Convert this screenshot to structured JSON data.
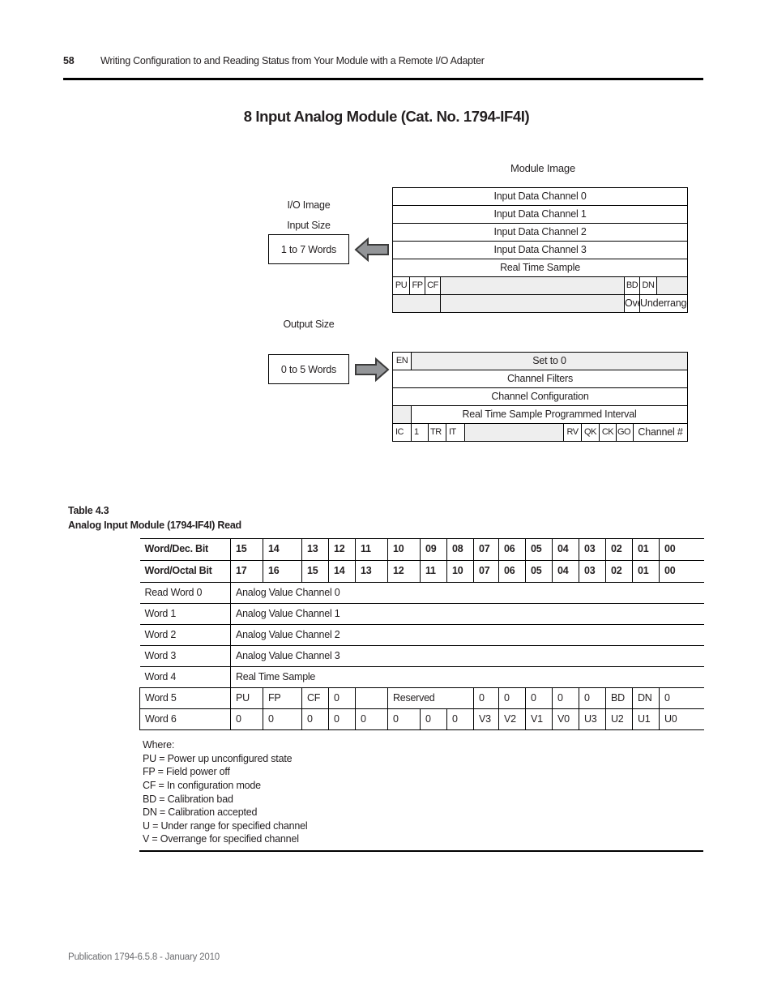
{
  "header": {
    "page_number": "58",
    "title": "Writing Configuration to and Reading Status from Your Module with a Remote I/O Adapter"
  },
  "section": {
    "title": "8 Input Analog Module (Cat. No. 1794-IF4I)"
  },
  "diagram": {
    "module_image_label": "Module Image",
    "io_image_label": "I/O Image",
    "input_size_label": "Input Size",
    "input_size_value": "1 to 7 Words",
    "output_size_label": "Output Size",
    "output_size_value": "0 to 5 Words",
    "input_arrow_icon": "arrow-left-icon",
    "output_arrow_icon": "arrow-right-icon",
    "input_rows": [
      "Input Data Channel 0",
      "Input Data Channel 1",
      "Input Data Channel 2",
      "Input Data Channel 3",
      "Real Time Sample"
    ],
    "input_status_row": {
      "pu": "PU",
      "fp": "FP",
      "cf": "CF",
      "bd": "BD",
      "dn": "DN"
    },
    "input_range_row": {
      "overrange": "Overrange",
      "underrange": "Underrange"
    },
    "output_row_1": {
      "en": "EN",
      "set_to_0": "Set to 0"
    },
    "output_rows": [
      "Channel  Filters",
      "Channel Configuration"
    ],
    "output_rts_row": {
      "label": "Real Time Sample Programmed Interval"
    },
    "output_bit_row": {
      "ic": "IC",
      "one": "1",
      "tr": "TR",
      "it": "IT",
      "rv": "RV",
      "qk": "QK",
      "ck": "CK",
      "go": "GO",
      "channel": "Channel #"
    }
  },
  "table": {
    "caption_line1": "Table 4.3",
    "caption_line2": "Analog Input Module (1794-IF4I) Read",
    "header_dec": {
      "label": "Word/Dec. Bit",
      "bits": [
        "15",
        "14",
        "13",
        "12",
        "11",
        "10",
        "09",
        "08",
        "07",
        "06",
        "05",
        "04",
        "03",
        "02",
        "01",
        "00"
      ]
    },
    "header_octal": {
      "label": "Word/Octal Bit",
      "bits": [
        "17",
        "16",
        "15",
        "14",
        "13",
        "12",
        "11",
        "10",
        "07",
        "06",
        "05",
        "04",
        "03",
        "02",
        "01",
        "00"
      ]
    },
    "spanned_rows": [
      {
        "word": "Read Word 0",
        "value": "Analog Value Channel 0"
      },
      {
        "word": "Word 1",
        "value": "Analog Value Channel 1"
      },
      {
        "word": "Word 2",
        "value": "Analog Value Channel 2"
      },
      {
        "word": "Word 3",
        "value": "Analog Value Channel 3"
      },
      {
        "word": "Word 4",
        "value": "Real Time Sample"
      }
    ],
    "word5": {
      "word": "Word 5",
      "cells": [
        "PU",
        "FP",
        "CF",
        "0",
        "",
        "Reserved",
        "0",
        "0",
        "0",
        "0",
        "0",
        "BD",
        "DN",
        "0"
      ]
    },
    "word6": {
      "word": "Word 6",
      "cells": [
        "0",
        "0",
        "0",
        "0",
        "0",
        "0",
        "0",
        "0",
        "V3",
        "V2",
        "V1",
        "V0",
        "U3",
        "U2",
        "U1",
        "U0"
      ]
    },
    "where": "Where:\nPU = Power up unconfigured state\nFP = Field power off\nCF = In configuration mode\nBD = Calibration bad\nDN = Calibration accepted\nU = Under range for specified channel\nV = Overrange for specified channel"
  },
  "footer": {
    "publication": "Publication 1794-6.5.8 - January 2010"
  },
  "colors": {
    "ink": "#231f20",
    "rule": "#000000",
    "shade": "#eeeeee",
    "arrow_fill": "#939598",
    "footer_text": "#6d6e71"
  }
}
